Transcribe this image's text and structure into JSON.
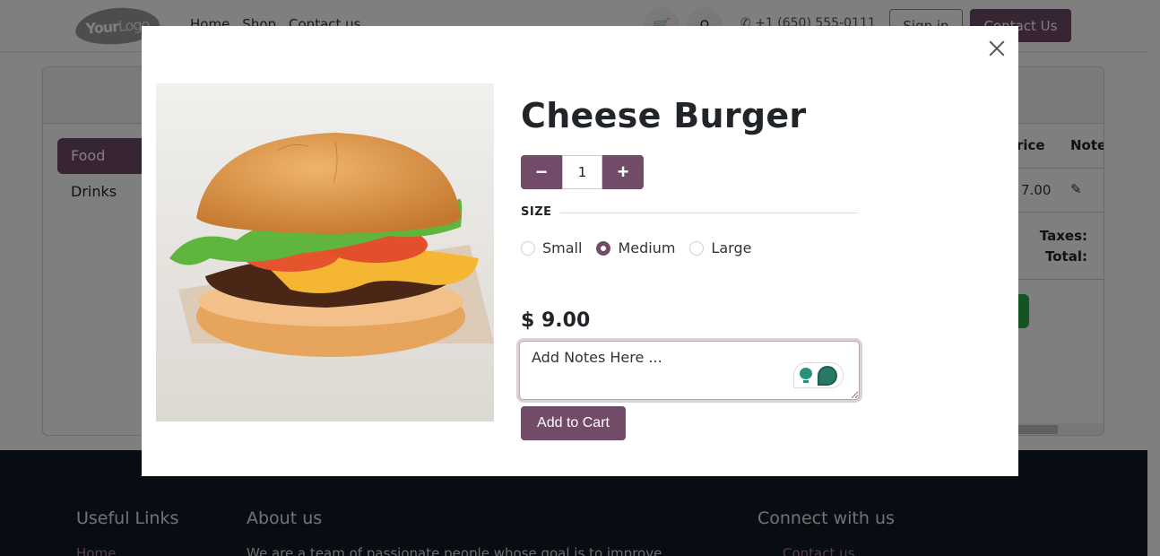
{
  "header": {
    "logo_bold": "Your",
    "logo_thin": "Logo",
    "nav": [
      "Home",
      "Shop",
      "Contact us"
    ],
    "cart_icon": "cart-icon",
    "search_icon": "search-icon",
    "phone": "+1 (650) 555-0111",
    "sign_in": "Sign in",
    "contact_us": "Contact Us"
  },
  "pos": {
    "categories": [
      {
        "label": "Food",
        "active": true
      },
      {
        "label": "Drinks",
        "active": false
      }
    ],
    "columns": {
      "price": "Price",
      "note": "Note"
    },
    "row": {
      "price": "7.00",
      "note_icon": "edit-icon"
    },
    "taxes_label": "Taxes:",
    "total_label": "Total:"
  },
  "footer": {
    "useful_links": "Useful Links",
    "about_us": "About us",
    "connect": "Connect with us",
    "link_home": "Home",
    "about_text": "We are a team of passionate people whose goal is to improve",
    "contact_link": "Contact us"
  },
  "modal": {
    "close_icon": "close-icon",
    "product_name": "Cheese Burger",
    "image_alt": "Cheese burger with lettuce, tomato and cheese",
    "quantity": "1",
    "minus": "−",
    "plus": "+",
    "size_label": "SIZE",
    "sizes": [
      {
        "label": "Small",
        "checked": false
      },
      {
        "label": "Medium",
        "checked": true
      },
      {
        "label": "Large",
        "checked": false
      }
    ],
    "price": "$ 9.00",
    "notes_value": "Add Notes Here ...",
    "add_to_cart": "Add to Cart"
  },
  "colors": {
    "brand": "#714b67",
    "footer_bg": "#111827",
    "assist_green": "#27917a"
  }
}
